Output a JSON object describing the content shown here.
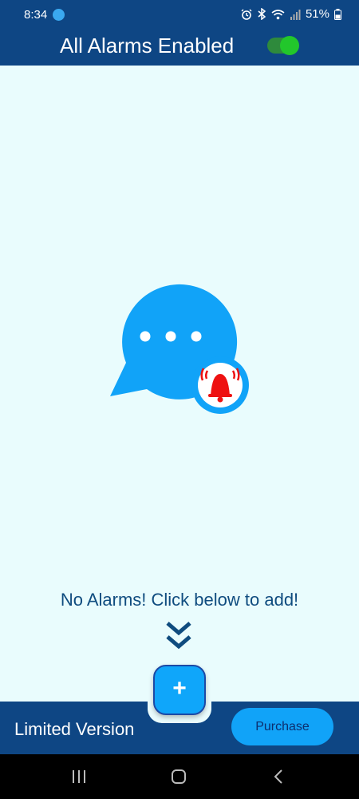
{
  "status_bar": {
    "time": "8:34",
    "battery": "51%",
    "icons": [
      "app-notification-icon",
      "alarm-icon",
      "bluetooth-icon",
      "wifi-icon",
      "signal-icon",
      "battery-icon"
    ]
  },
  "header": {
    "title": "All Alarms Enabled",
    "toggle_on": true
  },
  "main": {
    "illustration": "chat-bubble-alarm-icon",
    "empty_message": "No Alarms! Click below to add!",
    "hint_icon": "double-chevron-down-icon"
  },
  "fab": {
    "label": "+"
  },
  "bottom_bar": {
    "limited_label": "Limited Version",
    "purchase_label": "Purchase"
  },
  "nav": {
    "buttons": [
      "recent-apps-icon",
      "home-icon",
      "back-icon"
    ]
  },
  "colors": {
    "header_bg": "#0e4684",
    "page_bg": "#e9fcfd",
    "accent_blue": "#11a3f8",
    "alarm_red": "#ee1111",
    "toggle_green": "#22c72b",
    "message_text": "#0f4c7f"
  }
}
